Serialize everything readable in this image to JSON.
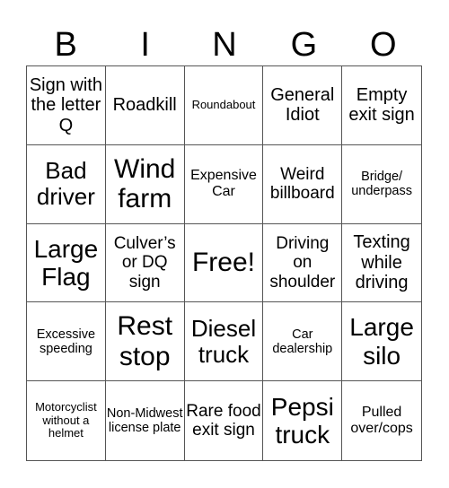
{
  "header": {
    "letters": [
      "B",
      "I",
      "N",
      "G",
      "O"
    ]
  },
  "cells": [
    "Sign with the letter Q",
    "Roadkill",
    "Roundabout",
    "General Idiot",
    "Empty exit sign",
    "Bad driver",
    "Wind farm",
    "Expensive Car",
    "Weird billboard",
    "Bridge/ underpass",
    "Large Flag",
    "Culver’s or DQ sign",
    "Free!",
    "Driving on shoulder",
    "Texting while driving",
    "Excessive speeding",
    "Rest stop",
    "Diesel truck",
    "Car dealership",
    "Large silo",
    "Motorcyclist without a helmet",
    "Non-Midwest license plate",
    "Rare food exit sign",
    "Pepsi truck",
    "Pulled over/cops"
  ]
}
